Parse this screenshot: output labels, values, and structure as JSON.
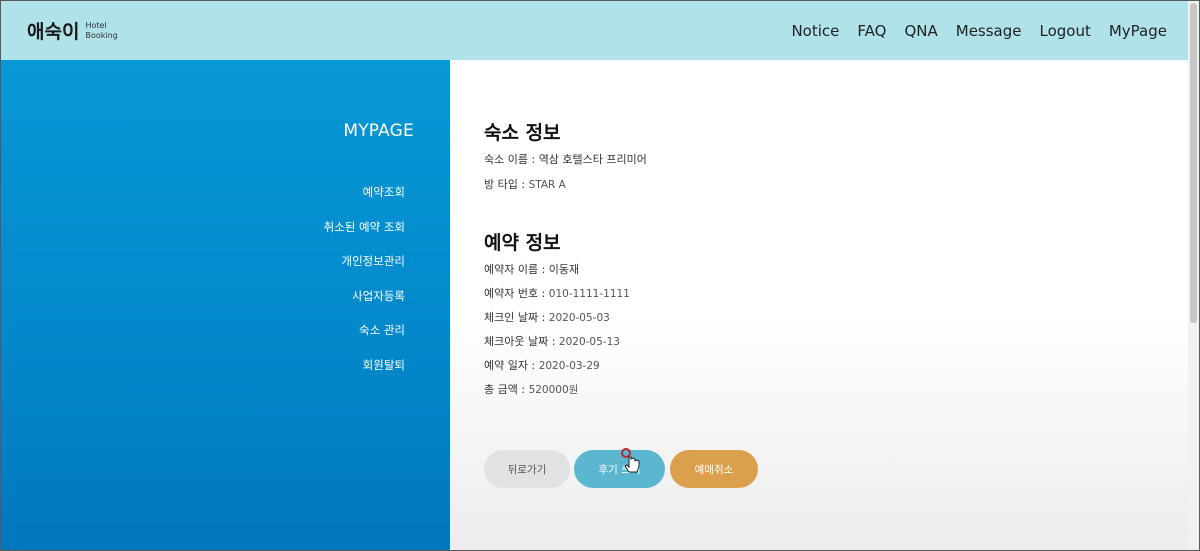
{
  "header": {
    "logo_main": "애숙이",
    "logo_sub_1": "Hotel",
    "logo_sub_2": "Booking",
    "nav": [
      "Notice",
      "FAQ",
      "QNA",
      "Message",
      "Logout",
      "MyPage"
    ]
  },
  "sidebar": {
    "title": "MYPAGE",
    "items": [
      "예약조회",
      "취소된 예약 조회",
      "개인정보관리",
      "사업자등록",
      "숙소 관리",
      "회원탈퇴"
    ]
  },
  "lodging": {
    "title": "숙소 정보",
    "name_label": "숙소 이름 : ",
    "name_value": "역삼 호텔스타 프리미어",
    "room_label": "방 타입 : ",
    "room_value": "STAR A"
  },
  "reservation": {
    "title": "예약 정보",
    "guest_label": "예약자 이름 : ",
    "guest_value": "이동재",
    "phone_label": "예약자 번호 : ",
    "phone_value": "010-1111-1111",
    "checkin_label": "체크인 날짜 : ",
    "checkin_value": "2020-05-03",
    "checkout_label": "체크아웃 날짜 : ",
    "checkout_value": "2020-05-13",
    "date_label": "예약 일자 : ",
    "date_value": "2020-03-29",
    "total_label": "총 금액 : ",
    "total_value": "520000원"
  },
  "buttons": {
    "back": "뒤로가기",
    "review": "후기 쓰기",
    "cancel": "예매취소"
  },
  "colors": {
    "header_bg": "#b0e2ea",
    "sidebar_bg": "#0898d6",
    "review_btn": "#5bb6d0",
    "cancel_btn": "#dba04e",
    "back_btn": "#e2e2e2"
  }
}
